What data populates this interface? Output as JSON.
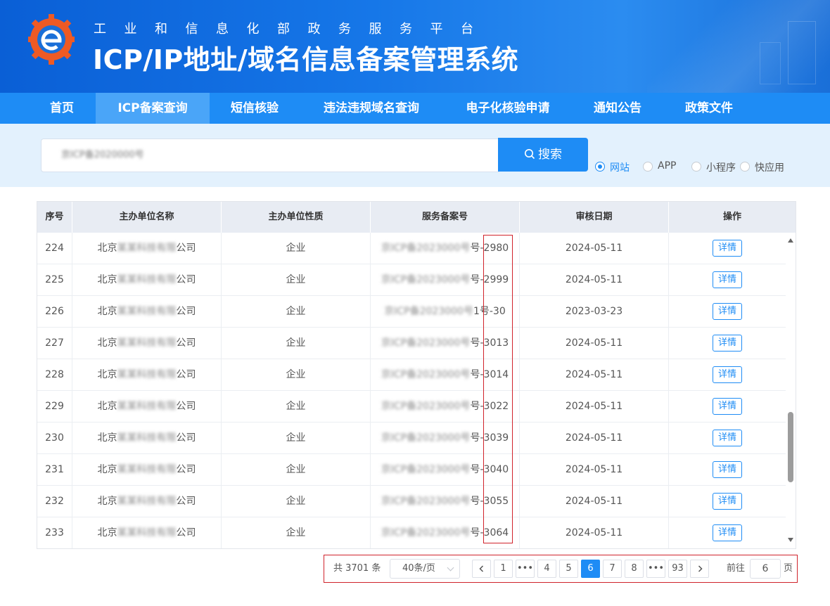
{
  "header": {
    "subtitle": "工业和信息化部政务服务平台",
    "title": "ICP/IP地址/域名信息备案管理系统",
    "colors": {
      "primary": "#1e8cf5",
      "nav_active": "#4aa5f8",
      "logo_orange": "#ee5a24",
      "logo_blue": "#1a6fd8"
    }
  },
  "nav": {
    "items": [
      {
        "label": "首页"
      },
      {
        "label": "ICP备案查询"
      },
      {
        "label": "短信核验"
      },
      {
        "label": "违法违规域名查询"
      },
      {
        "label": "电子化核验申请"
      },
      {
        "label": "通知公告"
      },
      {
        "label": "政策文件"
      }
    ],
    "active_index": 1
  },
  "search": {
    "value": "京ICP备2020000号",
    "button_label": "搜索",
    "icon": "search-icon",
    "radios": [
      {
        "label": "网站",
        "checked": true
      },
      {
        "label": "APP",
        "checked": false
      },
      {
        "label": "小程序",
        "checked": false
      },
      {
        "label": "快应用",
        "checked": false
      }
    ]
  },
  "table": {
    "headers": [
      "序号",
      "主办单位名称",
      "主办单位性质",
      "服务备案号",
      "审核日期",
      "操作"
    ],
    "rows": [
      {
        "no": "224",
        "org_prefix": "北京",
        "org_blur": "某某科技有限",
        "org_suffix": "公司",
        "type": "企业",
        "icp_blur": "京ICP备2023000号",
        "icp_suffix": "号-2980",
        "date": "2024-05-11",
        "action": "详情"
      },
      {
        "no": "225",
        "org_prefix": "北京",
        "org_blur": "某某科技有限",
        "org_suffix": "公司",
        "type": "企业",
        "icp_blur": "京ICP备2023000号",
        "icp_suffix": "号-2999",
        "date": "2024-05-11",
        "action": "详情"
      },
      {
        "no": "226",
        "org_prefix": "北京",
        "org_blur": "某某科技有限",
        "org_suffix": "公司",
        "type": "企业",
        "icp_blur": "京ICP备2023000号",
        "icp_suffix": "1号-30",
        "date": "2023-03-23",
        "action": "详情"
      },
      {
        "no": "227",
        "org_prefix": "北京",
        "org_blur": "某某科技有限",
        "org_suffix": "公司",
        "type": "企业",
        "icp_blur": "京ICP备2023000号",
        "icp_suffix": "号-3013",
        "date": "2024-05-11",
        "action": "详情"
      },
      {
        "no": "228",
        "org_prefix": "北京",
        "org_blur": "某某科技有限",
        "org_suffix": "公司",
        "type": "企业",
        "icp_blur": "京ICP备2023000号",
        "icp_suffix": "号-3014",
        "date": "2024-05-11",
        "action": "详情"
      },
      {
        "no": "229",
        "org_prefix": "北京",
        "org_blur": "某某科技有限",
        "org_suffix": "公司",
        "type": "企业",
        "icp_blur": "京ICP备2023000号",
        "icp_suffix": "号-3022",
        "date": "2024-05-11",
        "action": "详情"
      },
      {
        "no": "230",
        "org_prefix": "北京",
        "org_blur": "某某科技有限",
        "org_suffix": "公司",
        "type": "企业",
        "icp_blur": "京ICP备2023000号",
        "icp_suffix": "号-3039",
        "date": "2024-05-11",
        "action": "详情"
      },
      {
        "no": "231",
        "org_prefix": "北京",
        "org_blur": "某某科技有限",
        "org_suffix": "公司",
        "type": "企业",
        "icp_blur": "京ICP备2023000号",
        "icp_suffix": "号-3040",
        "date": "2024-05-11",
        "action": "详情"
      },
      {
        "no": "232",
        "org_prefix": "北京",
        "org_blur": "某某科技有限",
        "org_suffix": "公司",
        "type": "企业",
        "icp_blur": "京ICP备2023000号",
        "icp_suffix": "号-3055",
        "date": "2024-05-11",
        "action": "详情"
      },
      {
        "no": "233",
        "org_prefix": "北京",
        "org_blur": "某某科技有限",
        "org_suffix": "公司",
        "type": "企业",
        "icp_blur": "京ICP备2023000号",
        "icp_suffix": "号-3064",
        "date": "2024-05-11",
        "action": "详情"
      }
    ]
  },
  "pagination": {
    "total_text": "共 3701 条",
    "page_size": "40条/页",
    "pages": [
      "1",
      "•••",
      "4",
      "5",
      "6",
      "7",
      "8",
      "•••",
      "93"
    ],
    "current": "6",
    "goto_label": "前往",
    "goto_value": "6",
    "goto_unit": "页"
  }
}
